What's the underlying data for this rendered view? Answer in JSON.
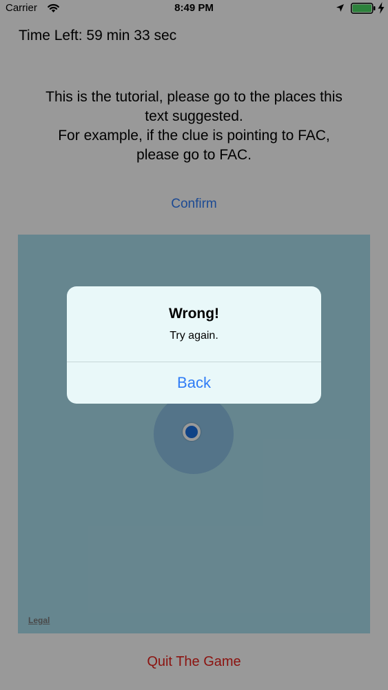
{
  "status_bar": {
    "carrier": "Carrier",
    "time": "8:49 PM"
  },
  "screen": {
    "time_left": "Time Left: 59 min 33 sec",
    "instructions": [
      "This is the tutorial, please go to the places this",
      "text suggested.",
      "For example, if the clue is pointing to FAC,",
      "please go to FAC."
    ],
    "confirm_label": "Confirm",
    "quit_label": "Quit The Game"
  },
  "map": {
    "legal_label": "Legal"
  },
  "alert": {
    "title": "Wrong!",
    "message": "Try again.",
    "button_label": "Back"
  },
  "colors": {
    "link_blue": "#2f7cf6",
    "quit_red": "#e8211b",
    "map_water": "#abdfee",
    "alert_background": "#e9f8f9",
    "battery_green": "#4cd964"
  }
}
